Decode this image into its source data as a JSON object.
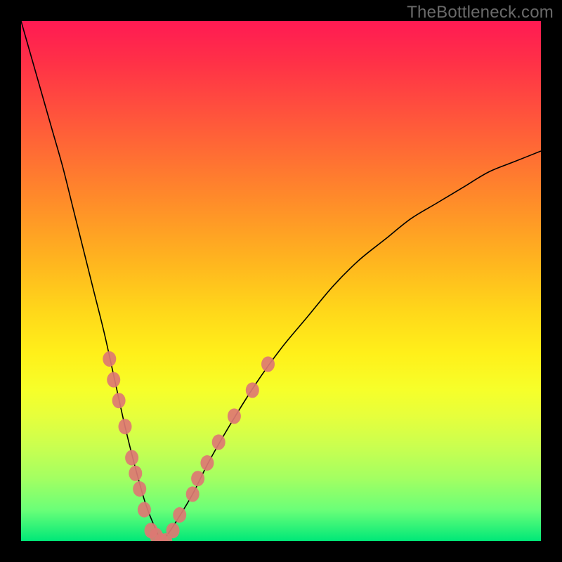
{
  "watermark": "TheBottleneck.com",
  "colors": {
    "frame": "#000000",
    "gradient_top": "#ff1a53",
    "gradient_mid": "#ffd81a",
    "gradient_bottom": "#00e878",
    "curve_stroke": "#000000",
    "marker_fill": "#dd7873"
  },
  "chart_data": {
    "type": "line",
    "title": "",
    "xlabel": "",
    "ylabel": "",
    "xlim": [
      0,
      100
    ],
    "ylim": [
      0,
      100
    ],
    "grid": false,
    "legend": false,
    "annotations": [
      "TheBottleneck.com"
    ],
    "description": "V-shaped bottleneck curve: y is mismatch percentage, minimized near x≈27 (optimal region). Curve rises steeply to ~100 at x=0 and more gradually toward ~75 at x=100. Background hue encodes y: green at low mismatch, red at high.",
    "series": [
      {
        "name": "bottleneck-curve",
        "x": [
          0,
          2,
          4,
          6,
          8,
          10,
          12,
          14,
          16,
          18,
          20,
          22,
          24,
          26,
          27,
          28,
          30,
          33,
          36,
          40,
          45,
          50,
          55,
          60,
          65,
          70,
          75,
          80,
          85,
          90,
          95,
          100
        ],
        "y": [
          100,
          93,
          86,
          79,
          72,
          64,
          56,
          48,
          40,
          31,
          22,
          14,
          7,
          2,
          0,
          1,
          4,
          9,
          15,
          22,
          30,
          37,
          43,
          49,
          54,
          58,
          62,
          65,
          68,
          71,
          73,
          75
        ]
      }
    ],
    "markers": [
      {
        "x": 17.0,
        "y": 35
      },
      {
        "x": 17.8,
        "y": 31
      },
      {
        "x": 18.8,
        "y": 27
      },
      {
        "x": 20.0,
        "y": 22
      },
      {
        "x": 21.3,
        "y": 16
      },
      {
        "x": 22.0,
        "y": 13
      },
      {
        "x": 22.8,
        "y": 10
      },
      {
        "x": 23.7,
        "y": 6
      },
      {
        "x": 25.0,
        "y": 2
      },
      {
        "x": 26.0,
        "y": 1
      },
      {
        "x": 27.0,
        "y": 0
      },
      {
        "x": 27.8,
        "y": 0
      },
      {
        "x": 29.2,
        "y": 2
      },
      {
        "x": 30.5,
        "y": 5
      },
      {
        "x": 33.0,
        "y": 9
      },
      {
        "x": 34.0,
        "y": 12
      },
      {
        "x": 35.8,
        "y": 15
      },
      {
        "x": 38.0,
        "y": 19
      },
      {
        "x": 41.0,
        "y": 24
      },
      {
        "x": 44.5,
        "y": 29
      },
      {
        "x": 47.5,
        "y": 34
      }
    ]
  }
}
